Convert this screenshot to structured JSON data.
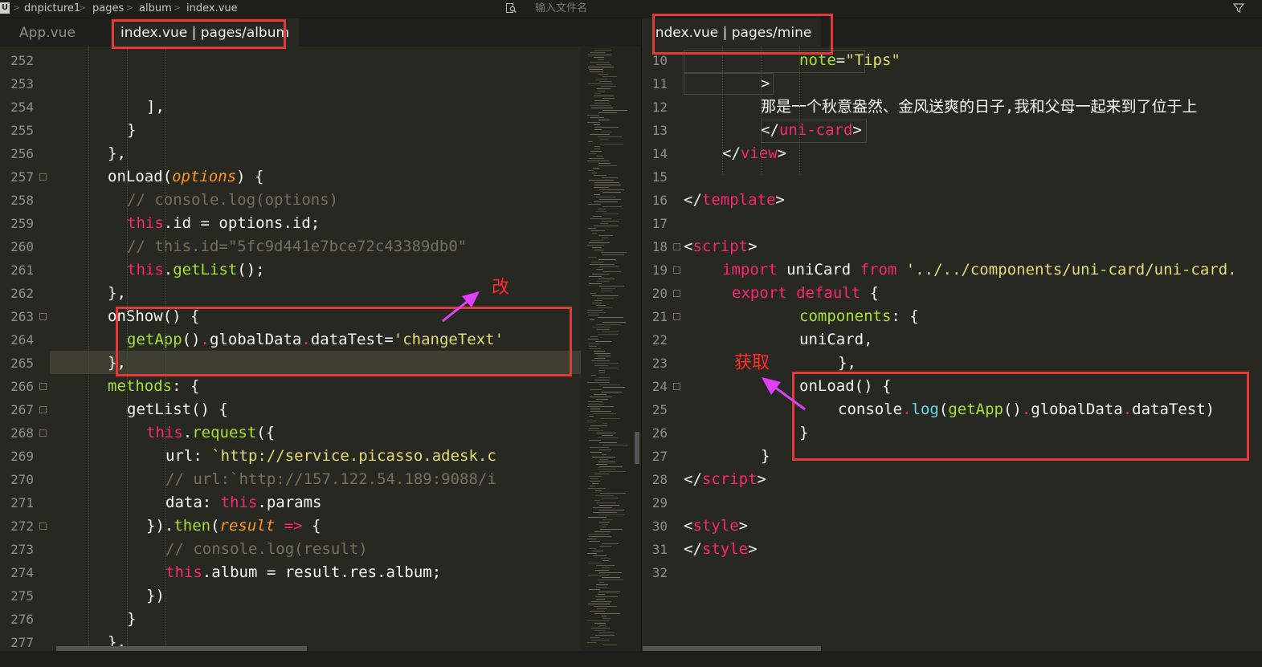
{
  "breadcrumb": {
    "items": [
      "dnpicture1",
      "pages",
      "album",
      "index.vue"
    ],
    "separator": ">"
  },
  "search": {
    "placeholder": "输入文件名"
  },
  "left_tabs": [
    "App.vue",
    "index.vue | pages/album"
  ],
  "right_tabs": [
    "index.vue | pages/mine"
  ],
  "annotations": {
    "change": "改",
    "get": "获取"
  },
  "colors": {
    "background": "#272822",
    "keyword": "#f92672",
    "function": "#a6e22e",
    "string": "#e6db74",
    "comment": "#75715e",
    "parameter": "#fd971f",
    "annotation": "#e53935",
    "arrow": "#e040fb"
  },
  "left_editor": {
    "current_line": 265,
    "lines": [
      {
        "n": "252",
        "fold": false,
        "segs": []
      },
      {
        "n": "253",
        "fold": false,
        "segs": []
      },
      {
        "n": "254",
        "fold": false,
        "segs": [
          [
            "",
            "],"
          ]
        ]
      },
      {
        "n": "255",
        "fold": false,
        "segs": [
          [
            "",
            "}"
          ]
        ]
      },
      {
        "n": "256",
        "fold": false,
        "segs": [
          [
            "",
            "},"
          ]
        ]
      },
      {
        "n": "257",
        "fold": true,
        "segs": [
          [
            "",
            "onLoad("
          ],
          [
            "par",
            "options"
          ],
          [
            "",
            ") {"
          ]
        ]
      },
      {
        "n": "258",
        "fold": false,
        "segs": [
          [
            "cm",
            "// console.log(options)"
          ]
        ]
      },
      {
        "n": "259",
        "fold": false,
        "segs": [
          [
            "kw",
            "this"
          ],
          [
            "",
            ".id = options.id;"
          ]
        ]
      },
      {
        "n": "260",
        "fold": false,
        "segs": [
          [
            "cm",
            "// this.id=\"5fc9d441e7bce72c43389db0\""
          ]
        ]
      },
      {
        "n": "261",
        "fold": false,
        "segs": [
          [
            "kw",
            "this"
          ],
          [
            "",
            "."
          ],
          [
            "fn",
            "getList"
          ],
          [
            "",
            "();"
          ]
        ]
      },
      {
        "n": "262",
        "fold": false,
        "segs": [
          [
            "",
            "},"
          ]
        ]
      },
      {
        "n": "263",
        "fold": true,
        "segs": [
          [
            "",
            "onShow() {"
          ]
        ]
      },
      {
        "n": "264",
        "fold": false,
        "segs": [
          [
            "fn",
            "getApp"
          ],
          [
            "",
            "()"
          ],
          [
            "kw",
            "."
          ],
          [
            "",
            "globalData"
          ],
          [
            "kw",
            "."
          ],
          [
            "",
            "dataTest="
          ],
          [
            "str",
            "'changeText'"
          ]
        ]
      },
      {
        "n": "265",
        "fold": false,
        "segs": [
          [
            "",
            "},"
          ]
        ]
      },
      {
        "n": "266",
        "fold": true,
        "segs": [
          [
            "fn",
            "methods"
          ],
          [
            "",
            ": {"
          ]
        ]
      },
      {
        "n": "267",
        "fold": true,
        "segs": [
          [
            "",
            "getList() {"
          ]
        ]
      },
      {
        "n": "268",
        "fold": true,
        "segs": [
          [
            "kw",
            "this"
          ],
          [
            "",
            "."
          ],
          [
            "fn",
            "request"
          ],
          [
            "",
            "({"
          ]
        ]
      },
      {
        "n": "269",
        "fold": false,
        "segs": [
          [
            "",
            "url: "
          ],
          [
            "str",
            "`http://service.picasso.adesk.c"
          ]
        ]
      },
      {
        "n": "270",
        "fold": false,
        "segs": [
          [
            "cm",
            "// url:`http://157.122.54.189:9088/i"
          ]
        ]
      },
      {
        "n": "271",
        "fold": false,
        "segs": [
          [
            "",
            "data: "
          ],
          [
            "kw",
            "this"
          ],
          [
            "",
            ".params"
          ]
        ]
      },
      {
        "n": "272",
        "fold": true,
        "segs": [
          [
            "",
            "})."
          ],
          [
            "fn",
            "then"
          ],
          [
            "",
            "("
          ],
          [
            "par",
            "result"
          ],
          [
            "kw",
            " =>"
          ],
          [
            "",
            " {"
          ]
        ]
      },
      {
        "n": "273",
        "fold": false,
        "segs": [
          [
            "cm",
            "// console.log(result)"
          ]
        ]
      },
      {
        "n": "274",
        "fold": false,
        "segs": [
          [
            "kw",
            "this"
          ],
          [
            "",
            ".album = result.res.album;"
          ]
        ]
      },
      {
        "n": "275",
        "fold": false,
        "segs": [
          [
            "",
            "})"
          ]
        ]
      },
      {
        "n": "276",
        "fold": false,
        "segs": [
          [
            "",
            "}"
          ]
        ]
      },
      {
        "n": "277",
        "fold": false,
        "segs": [
          [
            "",
            "},"
          ]
        ]
      }
    ]
  },
  "right_editor": {
    "lines": [
      {
        "n": "10",
        "fold": false,
        "segs": [
          [
            "fn",
            "note"
          ],
          [
            "",
            "="
          ],
          [
            "str",
            "\"Tips\""
          ]
        ]
      },
      {
        "n": "11",
        "fold": false,
        "segs": [
          [
            "",
            ">"
          ]
        ]
      },
      {
        "n": "12",
        "fold": false,
        "segs": [
          [
            "",
            "那是一个秋意盎然、金风送爽的日子,我和父母一起来到了位于上"
          ]
        ]
      },
      {
        "n": "13",
        "fold": false,
        "segs": [
          [
            "",
            "</"
          ],
          [
            "tg",
            "uni-card"
          ],
          [
            "",
            ">"
          ]
        ]
      },
      {
        "n": "14",
        "fold": false,
        "segs": [
          [
            "",
            "</"
          ],
          [
            "tg",
            "view"
          ],
          [
            "",
            ">"
          ]
        ]
      },
      {
        "n": "15",
        "fold": false,
        "segs": []
      },
      {
        "n": "16",
        "fold": false,
        "segs": [
          [
            "",
            "</"
          ],
          [
            "tg",
            "template"
          ],
          [
            "",
            ">"
          ]
        ]
      },
      {
        "n": "17",
        "fold": false,
        "segs": []
      },
      {
        "n": "18",
        "fold": true,
        "segs": [
          [
            "",
            "<"
          ],
          [
            "tg",
            "script"
          ],
          [
            "",
            ">"
          ]
        ]
      },
      {
        "n": "19",
        "fold": true,
        "segs": [
          [
            "kw",
            "import"
          ],
          [
            "",
            " uniCard "
          ],
          [
            "kw",
            "from"
          ],
          [
            "str",
            " '../../components/uni-card/uni-card."
          ]
        ]
      },
      {
        "n": "20",
        "fold": true,
        "segs": [
          [
            "kw",
            "export default"
          ],
          [
            "",
            " {"
          ]
        ]
      },
      {
        "n": "21",
        "fold": true,
        "segs": [
          [
            "fn",
            "components"
          ],
          [
            "",
            ": {"
          ]
        ]
      },
      {
        "n": "22",
        "fold": false,
        "segs": [
          [
            "",
            "uniCard,"
          ]
        ]
      },
      {
        "n": "23",
        "fold": false,
        "segs": [
          [
            "",
            "},"
          ]
        ]
      },
      {
        "n": "24",
        "fold": true,
        "segs": [
          [
            "",
            "onLoad() {"
          ]
        ]
      },
      {
        "n": "25",
        "fold": false,
        "segs": [
          [
            "",
            "console"
          ],
          [
            "kw",
            "."
          ],
          [
            "cy",
            "log"
          ],
          [
            "",
            "("
          ],
          [
            "fn",
            "getApp"
          ],
          [
            "",
            "()"
          ],
          [
            "kw",
            "."
          ],
          [
            "",
            "globalData"
          ],
          [
            "kw",
            "."
          ],
          [
            "",
            "dataTest)"
          ]
        ]
      },
      {
        "n": "26",
        "fold": false,
        "segs": [
          [
            "",
            "}"
          ]
        ]
      },
      {
        "n": "27",
        "fold": false,
        "segs": [
          [
            "",
            "}"
          ]
        ]
      },
      {
        "n": "28",
        "fold": false,
        "segs": [
          [
            "",
            "</"
          ],
          [
            "tg",
            "script"
          ],
          [
            "",
            ">"
          ]
        ]
      },
      {
        "n": "29",
        "fold": false,
        "segs": []
      },
      {
        "n": "30",
        "fold": false,
        "segs": [
          [
            "",
            "<"
          ],
          [
            "tg",
            "style"
          ],
          [
            "",
            ">"
          ]
        ]
      },
      {
        "n": "31",
        "fold": false,
        "segs": [
          [
            "",
            "</"
          ],
          [
            "tg",
            "style"
          ],
          [
            "",
            ">"
          ]
        ]
      },
      {
        "n": "32",
        "fold": false,
        "segs": []
      }
    ]
  }
}
